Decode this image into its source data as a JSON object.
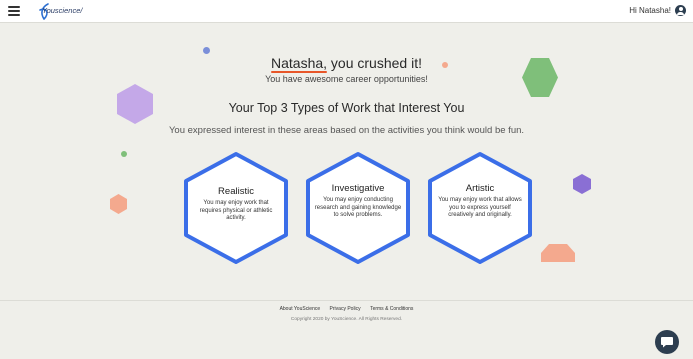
{
  "header": {
    "logo_text": "Youscience/",
    "greeting": "Hi Natasha!",
    "menu_icon": "hamburger-menu-icon",
    "user_icon": "user-circle-icon"
  },
  "hero": {
    "name": "Natasha,",
    "title_rest": " you crushed it!",
    "subtitle": "You have awesome career opportunities!"
  },
  "section": {
    "title": "Your Top 3 Types of Work that Interest You",
    "subtitle": "You expressed interest in these areas based on the activities you think would be fun."
  },
  "cards": [
    {
      "title": "Realistic",
      "description": "You may enjoy work that requires physical or athletic activity."
    },
    {
      "title": "Investigative",
      "description": "You may enjoy conducting research and gaining knowledge to solve problems."
    },
    {
      "title": "Artistic",
      "description": "You may enjoy work that allows you to express yourself creatively and originally."
    }
  ],
  "footer": {
    "links": [
      "About YouScience",
      "Privacy Policy",
      "Terms & Conditions"
    ],
    "copyright": "Copyright 2020 by YouScience. All Rights Reserved."
  },
  "chat": {
    "icon": "chat-bubble-icon"
  },
  "colors": {
    "accent": "#e8572a",
    "hex_border": "#3b6ee8",
    "purple": "#c4a8e8",
    "green": "#7fbf7a",
    "salmon": "#f4a98e",
    "violet": "#8a6fd4",
    "blue_dot": "#7b8fd9",
    "navy": "#2d3e50"
  }
}
